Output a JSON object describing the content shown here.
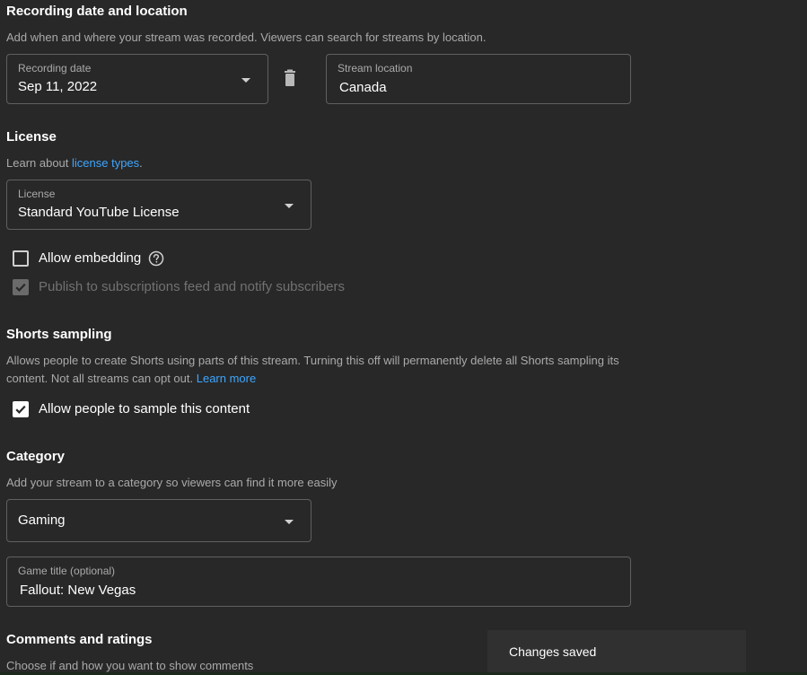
{
  "recording": {
    "title": "Recording date and location",
    "description": "Add when and where your stream was recorded. Viewers can search for streams by location.",
    "date_label": "Recording date",
    "date_value": "Sep 11, 2022",
    "location_label": "Stream location",
    "location_value": "Canada"
  },
  "license": {
    "title": "License",
    "learn_prefix": "Learn about ",
    "learn_link": "license types",
    "learn_suffix": ".",
    "field_label": "License",
    "field_value": "Standard YouTube License",
    "allow_embedding": "Allow embedding",
    "publish_feed": "Publish to subscriptions feed and notify subscribers"
  },
  "shorts": {
    "title": "Shorts sampling",
    "description": "Allows people to create Shorts using parts of this stream. Turning this off will permanently delete all Shorts sampling its content. Not all streams can opt out.",
    "learn_more": "Learn more",
    "allow_sample": "Allow people to sample this content"
  },
  "category": {
    "title": "Category",
    "description": "Add your stream to a category so viewers can find it more easily",
    "value": "Gaming",
    "game_label": "Game title (optional)",
    "game_value": "Fallout: New Vegas"
  },
  "comments": {
    "title": "Comments and ratings",
    "description": "Choose if and how you want to show comments"
  },
  "toast": {
    "message": "Changes saved"
  },
  "colors": {
    "background": "#282828",
    "link": "#3ea6ff",
    "border": "#606060"
  }
}
